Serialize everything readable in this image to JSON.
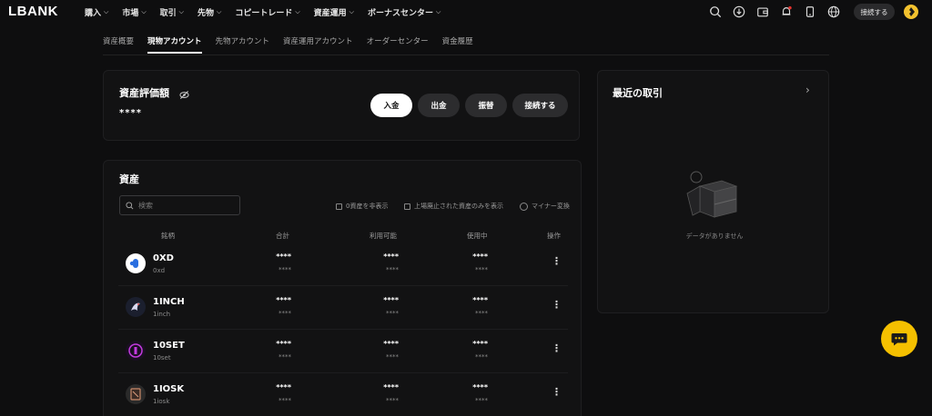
{
  "brand": "LBANK",
  "nav": {
    "menu": [
      "購入",
      "市場",
      "取引",
      "先物",
      "コピートレード",
      "資産運用",
      "ボーナスセンター"
    ],
    "connect_label": "接続する",
    "icons": [
      "search-icon",
      "download-icon",
      "wallet-icon",
      "bell-icon",
      "mobile-icon",
      "globe-icon"
    ]
  },
  "subtabs": [
    "資産概要",
    "現物アカウント",
    "先物アカウント",
    "資産運用アカウント",
    "オーダーセンター",
    "資金履歴"
  ],
  "valuation": {
    "title": "資産評価額",
    "value": "****",
    "buttons": {
      "deposit": "入金",
      "withdraw": "出金",
      "transfer": "振替",
      "connect": "接続する"
    }
  },
  "assets": {
    "title": "資産",
    "search_placeholder": "検索",
    "options": {
      "hide_zero": "0資産を非表示",
      "only_delisted": "上場廃止された資産のみを表示",
      "minor_convert": "マイナー変換"
    },
    "columns": [
      "銘柄",
      "合計",
      "利用可能",
      "使用中",
      "操作"
    ],
    "rows": [
      {
        "symbol": "0XD",
        "name": "0xd",
        "total": "****",
        "total_sub": "****",
        "available": "****",
        "available_sub": "****",
        "in_use": "****",
        "in_use_sub": "****"
      },
      {
        "symbol": "1INCH",
        "name": "1inch",
        "total": "****",
        "total_sub": "****",
        "available": "****",
        "available_sub": "****",
        "in_use": "****",
        "in_use_sub": "****"
      },
      {
        "symbol": "10SET",
        "name": "10set",
        "total": "****",
        "total_sub": "****",
        "available": "****",
        "available_sub": "****",
        "in_use": "****",
        "in_use_sub": "****"
      },
      {
        "symbol": "1IOSK",
        "name": "1iosk",
        "total": "****",
        "total_sub": "****",
        "available": "****",
        "available_sub": "****",
        "in_use": "****",
        "in_use_sub": "****"
      }
    ]
  },
  "recent": {
    "title": "最近の取引",
    "empty_text": "データがありません"
  },
  "colors": {
    "background": "#0e0e0f",
    "card": "#121213",
    "accent": "#f5c000"
  }
}
